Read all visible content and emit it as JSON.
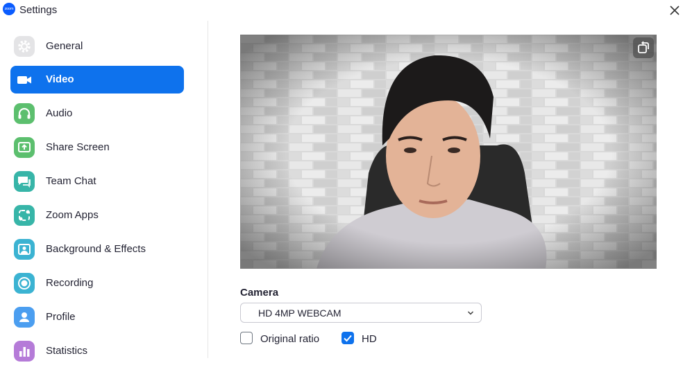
{
  "window": {
    "title": "Settings",
    "logo_text": "zoom"
  },
  "sidebar": {
    "items": [
      {
        "label": "General",
        "icon": "gear-icon",
        "color": "#e4e4e6",
        "active": false
      },
      {
        "label": "Video",
        "icon": "video-camera-icon",
        "color": "#0e72ed",
        "active": true
      },
      {
        "label": "Audio",
        "icon": "headphones-icon",
        "color": "#5cbf6e",
        "active": false
      },
      {
        "label": "Share Screen",
        "icon": "share-screen-icon",
        "color": "#5cbf6e",
        "active": false
      },
      {
        "label": "Team Chat",
        "icon": "chat-icon",
        "color": "#37b5a8",
        "active": false
      },
      {
        "label": "Zoom Apps",
        "icon": "apps-icon",
        "color": "#37b5a8",
        "active": false
      },
      {
        "label": "Background & Effects",
        "icon": "background-icon",
        "color": "#3bb3d2",
        "active": false
      },
      {
        "label": "Recording",
        "icon": "recording-icon",
        "color": "#3bb3d2",
        "active": false
      },
      {
        "label": "Profile",
        "icon": "profile-icon",
        "color": "#4b9ef0",
        "active": false
      },
      {
        "label": "Statistics",
        "icon": "statistics-icon",
        "color": "#b57bd8",
        "active": false
      }
    ]
  },
  "main": {
    "camera_label": "Camera",
    "camera_value": "HD 4MP WEBCAM",
    "original_ratio_label": "Original ratio",
    "original_ratio_checked": false,
    "hd_label": "HD",
    "hd_checked": true
  }
}
